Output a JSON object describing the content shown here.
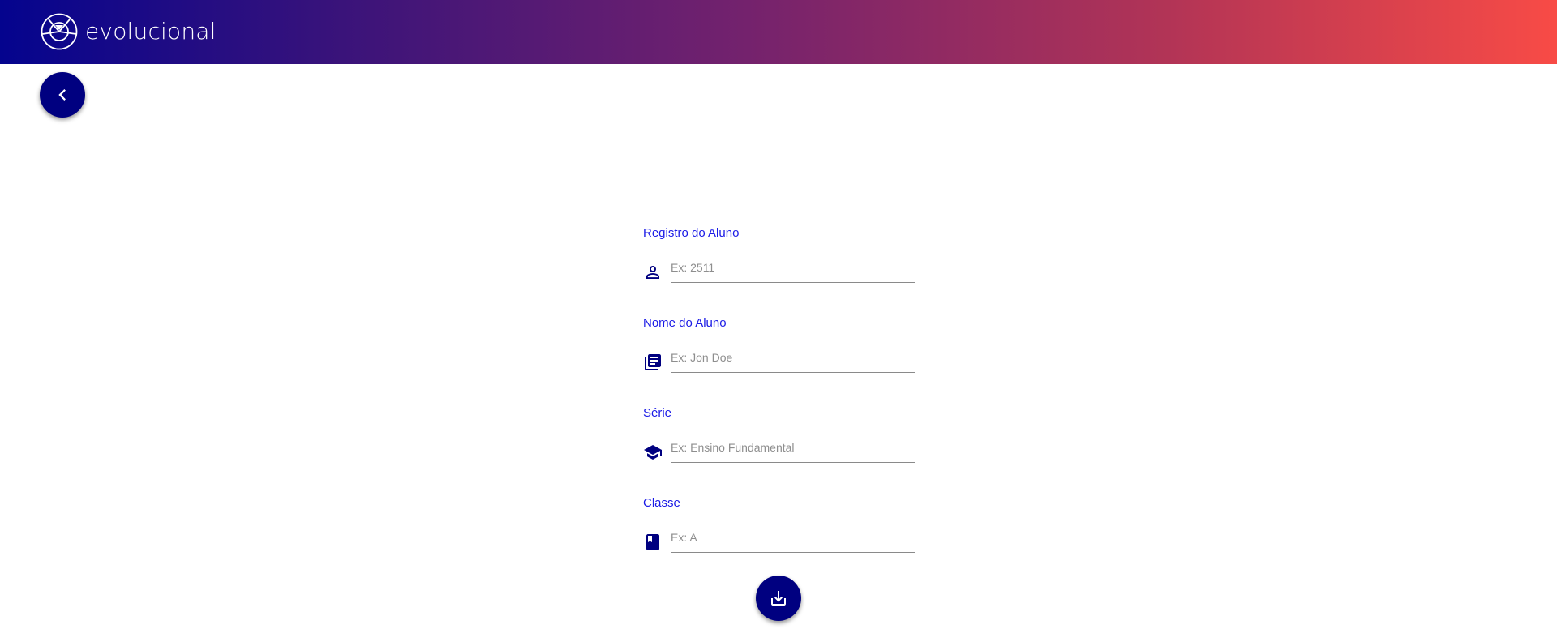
{
  "header": {
    "brand_name": "evolucional",
    "logo_icon": "evolucional-logo-icon"
  },
  "nav": {
    "back_icon": "chevron-left-icon"
  },
  "form": {
    "fields": [
      {
        "label": "Registro do Aluno",
        "placeholder": "Ex: 2511",
        "value": "",
        "icon": "person-icon"
      },
      {
        "label": "Nome do Aluno",
        "placeholder": "Ex: Jon Doe",
        "value": "",
        "icon": "library-books-icon"
      },
      {
        "label": "Série",
        "placeholder": "Ex: Ensino Fundamental",
        "value": "",
        "icon": "graduation-cap-icon"
      },
      {
        "label": "Classe",
        "placeholder": "Ex: A",
        "value": "",
        "icon": "book-icon"
      }
    ],
    "submit_icon": "download-icon"
  },
  "colors": {
    "primary": "#000080",
    "label": "#1a1ae6",
    "gradient_start": "#04048e",
    "gradient_end": "#f84b46"
  }
}
